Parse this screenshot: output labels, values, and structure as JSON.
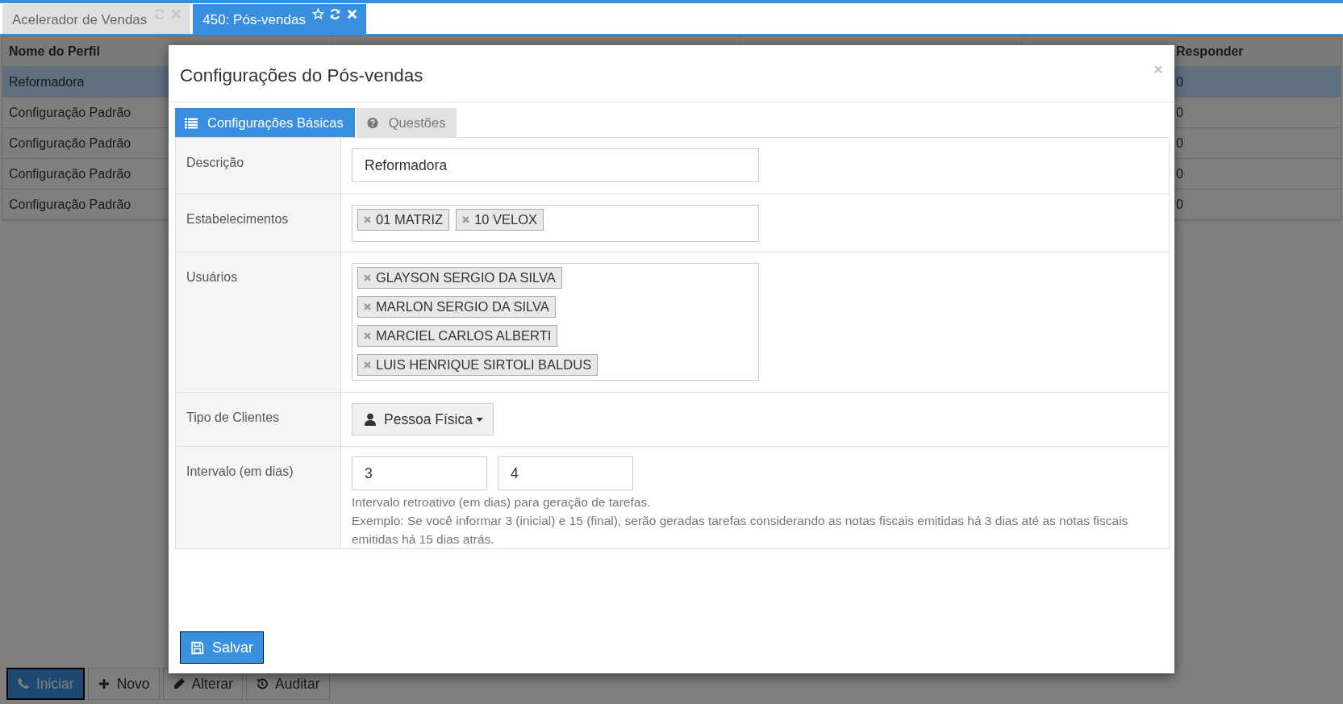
{
  "tabs": [
    {
      "label": "Acelerador de Vendas",
      "selected": false
    },
    {
      "label": "450: Pós-vendas",
      "selected": true
    }
  ],
  "table": {
    "columns": [
      "Nome do Perfil",
      "Responder"
    ],
    "rows": [
      {
        "name": "Reformadora",
        "responder": "0",
        "selected": true
      },
      {
        "name": "Configuração Padrão",
        "responder": "0",
        "selected": false
      },
      {
        "name": "Configuração Padrão",
        "responder": "0",
        "selected": false
      },
      {
        "name": "Configuração Padrão",
        "responder": "0",
        "selected": false
      },
      {
        "name": "Configuração Padrão",
        "responder": "0",
        "selected": false
      }
    ]
  },
  "toolbar": [
    {
      "label": "Iniciar",
      "kind": "phone",
      "primary": true
    },
    {
      "label": "Novo",
      "kind": "plus",
      "primary": false
    },
    {
      "label": "Alterar",
      "kind": "pencil",
      "primary": false
    },
    {
      "label": "Auditar",
      "kind": "history",
      "primary": false
    }
  ],
  "modal": {
    "title": "Configurações do Pós-vendas",
    "tabs": [
      {
        "label": "Configurações Básicas",
        "kind": "list",
        "selected": true
      },
      {
        "label": "Questões",
        "kind": "question",
        "selected": false
      }
    ],
    "descricao": {
      "label": "Descrição",
      "value": "Reformadora"
    },
    "estabelecimentos": {
      "label": "Estabelecimentos",
      "tags": [
        "01 MATRIZ",
        "10 VELOX"
      ]
    },
    "usuarios": {
      "label": "Usuários",
      "tags": [
        "GLAYSON SERGIO DA SILVA",
        "MARLON SERGIO DA SILVA",
        "MARCIEL CARLOS ALBERTI",
        "LUIS HENRIQUE SIRTOLI BALDUS"
      ]
    },
    "tipo_clientes": {
      "label": "Tipo de Clientes",
      "value": "Pessoa Física"
    },
    "intervalo": {
      "label": "Intervalo (em dias)",
      "start": "3",
      "end": "4",
      "help": [
        "Intervalo retroativo (em dias) para geração de tarefas.",
        "Exemplo: Se você informar 3 (inicial) e 15 (final), serão geradas tarefas considerando as notas fiscais emitidas há 3 dias até as notas fiscais emitidas há 15 dias atrás."
      ]
    },
    "save_button": "Salvar"
  }
}
